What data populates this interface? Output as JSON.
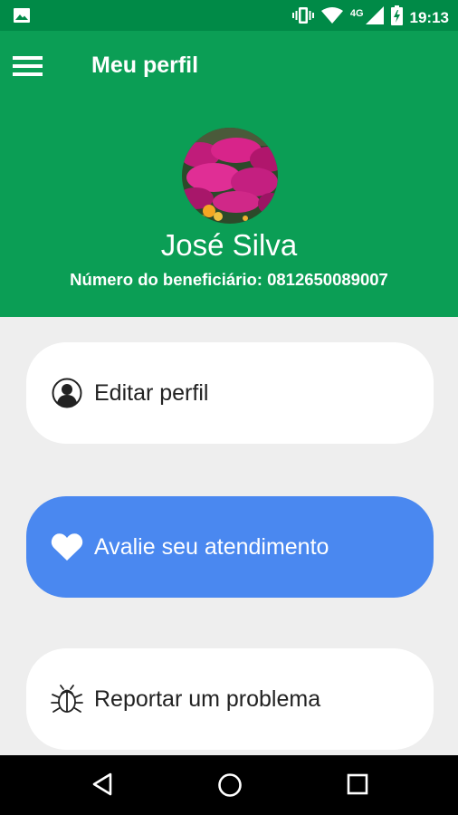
{
  "status_bar": {
    "time": "19:13",
    "network": "4G",
    "icons": [
      "image-icon",
      "vibrate-icon",
      "wifi-icon",
      "signal-icon",
      "battery-icon"
    ]
  },
  "app_bar": {
    "title": "Meu perfil",
    "menu_icon": "hamburger-menu-icon"
  },
  "profile": {
    "name": "José Silva",
    "beneficiary_number": "Número do beneficiário: 0812650089007"
  },
  "actions": [
    {
      "label": "Editar perfil",
      "icon": "user-circle-icon"
    },
    {
      "label": "Avalie seu atendimento",
      "icon": "heart-icon"
    },
    {
      "label": "Reportar um problema",
      "icon": "bug-icon"
    }
  ],
  "nav_bar": {
    "icons": [
      "back-icon",
      "home-icon",
      "recents-icon"
    ]
  },
  "colors": {
    "status_bar": "#008a47",
    "app_bar": "#0b9e55",
    "background": "#eeeeee",
    "primary_card": "#4a88f0",
    "card": "#ffffff"
  }
}
